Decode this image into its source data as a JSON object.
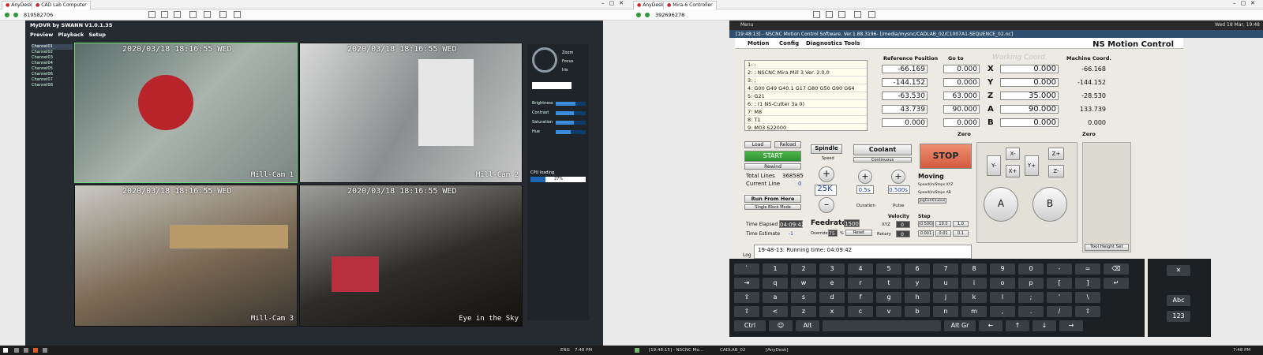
{
  "left": {
    "tab1": "AnyDesk",
    "tab2": "CAD Lab Computer",
    "session_id": "819582706",
    "dvr": {
      "title": "MyDVR by SWANN  V1.0.1.35",
      "menu": [
        "Preview",
        "Playback",
        "Setup"
      ],
      "channels": [
        "Channel01",
        "Channel02",
        "Channel03",
        "Channel04",
        "Channel05",
        "Channel06",
        "Channel07",
        "Channel08"
      ],
      "cams": [
        {
          "ts": "2020/03/18 18:16:55 WED",
          "name": "Mill-Cam 1"
        },
        {
          "ts": "2020/03/18 18:16:55 WED",
          "name": "Mill-Cam 2"
        },
        {
          "ts": "2020/03/18 18:16:55 WED",
          "name": "Mill-Cam 3"
        },
        {
          "ts": "2020/03/18 18:16:55 WED",
          "name": "Eye in the Sky"
        }
      ],
      "ptz": [
        "Zoom",
        "Focus",
        "Iris"
      ],
      "sliders": [
        {
          "label": "Brightness",
          "level": 0.65
        },
        {
          "label": "Contrast",
          "level": 0.6
        },
        {
          "label": "Saturation",
          "level": 0.6
        },
        {
          "label": "Hue",
          "level": 0.5
        }
      ],
      "cpu_label": "CPU loading",
      "cpu_value": "27%",
      "cpu_level": 0.27
    },
    "taskbar_time": "7:48 PM",
    "taskbar_lang": "ENG"
  },
  "right": {
    "tab1": "AnyDesk",
    "tab2": "Mira-6 Controller",
    "session_id": "392696278",
    "mp_menu": "Menu",
    "mp_date": "Wed 18 Mar, 19:48",
    "titlebar": "[19:48:13] - NSCNC Motion Control Software. Ver.1.88.3196- [/media/mysnc/CADLAB_02/C1007A1-SEQUENCE_02.nc]",
    "app_title": "NS Motion Control",
    "menu": [
      "Motion",
      "Config",
      "Diagnostics Tools"
    ],
    "gcode": [
      "1: :",
      "2: ; NSCNC Mira Mill 3 Ver. 2.0.0",
      "3: ;",
      "4: G00 G49 G40.1 G17 G80 G50 G90 G64",
      "5: G21",
      "6: ; (1 NS-Cutter 3a 0)",
      "7: M8",
      "8: T1",
      "9: M03 S22000"
    ],
    "ref_header": "Reference Position",
    "goto": "Go to",
    "wc_header": "Working Coord.",
    "mc_header": "Machine Coord.",
    "axes": [
      {
        "a": "X",
        "ref": "-66.169",
        "go": "0.000",
        "wc": "0.000",
        "mc": "-66.168"
      },
      {
        "a": "Y",
        "ref": "-144.152",
        "go": "0.000",
        "wc": "0.000",
        "mc": "-144.152"
      },
      {
        "a": "Z",
        "ref": "-63.530",
        "go": "63.000",
        "wc": "35.000",
        "mc": "-28.530"
      },
      {
        "a": "A",
        "ref": "43.739",
        "go": "90.000",
        "wc": "90.000",
        "mc": "133.739"
      },
      {
        "a": "B",
        "ref": "0.000",
        "go": "0.000",
        "wc": "0.000",
        "mc": "0.000"
      }
    ],
    "zero": "Zero",
    "load": "Load",
    "reload": "Reload",
    "start": "START",
    "rewind": "Rewind",
    "total_lines_label": "Total Lines",
    "total_lines": "368585",
    "current_line_label": "Current Line",
    "current_line": "0",
    "run_from_here": "Run From Here",
    "single_block": "Single Block Mode",
    "spindle": "Spindle",
    "speed": "Speed",
    "rpm": "25K",
    "coolant": "Coolant",
    "continuous": "Continuous",
    "duration_val": "0.5s",
    "pulse_val": "0.500s",
    "duration": "Duration",
    "pulse": "Pulse",
    "stop": "STOP",
    "moving": "Moving",
    "speed_xyz": "Speed(In/Steps XYZ",
    "speed_ab": "Speed(In/Steps AB",
    "jog": "JogContinuous",
    "te_label": "Time Elapsed",
    "te": "04:09:42",
    "test_label": "Time Estimate",
    "test": "-1",
    "feedrate": "Feedrate",
    "feed_val": "1500",
    "override": "Override",
    "ov_val": "75",
    "ov_pct": "%",
    "reset": "Reset",
    "velocity": "Velocity",
    "vxyz": "XYZ",
    "vxyz_v": "0",
    "vrot": "Rotary",
    "vrot_v": "0",
    "step": "Step",
    "steps": [
      "(0.500)",
      "10.0",
      "1.0",
      "0.001",
      "0.01",
      "0.1"
    ],
    "log_label": "Log",
    "log": "19-48-13: Running time: 04:09:42",
    "jog_btns": [
      "Y-",
      "X-",
      "X+",
      "Y+",
      "Z+",
      "Z-"
    ],
    "rot": [
      "A",
      "B"
    ],
    "tool_height": "Tool Height Set",
    "kb_rows": [
      [
        "`",
        "1",
        "2",
        "3",
        "4",
        "5",
        "6",
        "7",
        "8",
        "9",
        "0",
        "-",
        "=",
        "⌫"
      ],
      [
        "⇥",
        "q",
        "w",
        "e",
        "r",
        "t",
        "y",
        "u",
        "i",
        "o",
        "p",
        "[",
        "]",
        "↵"
      ],
      [
        "⇪",
        "a",
        "s",
        "d",
        "f",
        "g",
        "h",
        "j",
        "k",
        "l",
        ";",
        "'",
        "\\"
      ],
      [
        "⇧",
        "<",
        "z",
        "x",
        "c",
        "v",
        "b",
        "n",
        "m",
        ",",
        ".",
        "/",
        "⇧"
      ],
      [
        "Ctrl",
        "☺",
        "Alt",
        " ",
        "Alt Gr",
        "←",
        "↑",
        "↓",
        "→"
      ]
    ],
    "kb_side": [
      "✕",
      "Abc",
      "123"
    ],
    "taskbar": [
      "[19:48:15] - NSCNC Mo...",
      "CADLAB_02",
      "[AnyDesk]"
    ],
    "taskbar_time": "7:48 PM"
  }
}
